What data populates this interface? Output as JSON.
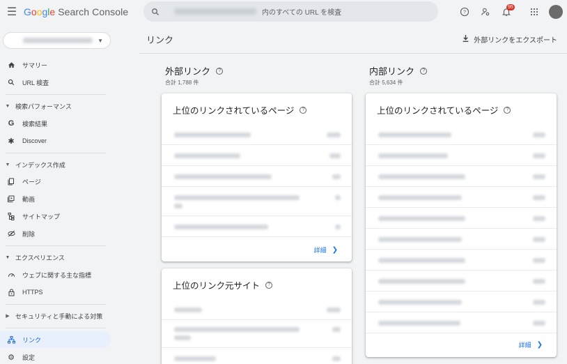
{
  "header": {
    "logo_google": [
      "G",
      "o",
      "o",
      "g",
      "l",
      "e"
    ],
    "logo_product": "Search Console",
    "search_placeholder": "内のすべての URL を検査",
    "notification_count": "95"
  },
  "sidebar": {
    "items": [
      {
        "label": "サマリー",
        "icon": "home-icon"
      },
      {
        "label": "URL 検査",
        "icon": "search-icon"
      }
    ],
    "section_performance": "検索パフォーマンス",
    "performance_items": [
      {
        "label": "検索結果",
        "icon": "google-g-icon"
      },
      {
        "label": "Discover",
        "icon": "discover-icon"
      }
    ],
    "section_index": "インデックス作成",
    "index_items": [
      {
        "label": "ページ",
        "icon": "pages-icon"
      },
      {
        "label": "動画",
        "icon": "video-icon"
      },
      {
        "label": "サイトマップ",
        "icon": "sitemap-icon"
      },
      {
        "label": "削除",
        "icon": "removals-icon"
      }
    ],
    "section_experience": "エクスペリエンス",
    "experience_items": [
      {
        "label": "ウェブに関する主な指標",
        "icon": "gauge-icon"
      },
      {
        "label": "HTTPS",
        "icon": "lock-icon"
      }
    ],
    "section_security": "セキュリティと手動による対策",
    "bottom_items": [
      {
        "label": "リンク",
        "icon": "links-icon",
        "active": true
      },
      {
        "label": "設定",
        "icon": "gear-icon"
      }
    ]
  },
  "main": {
    "title": "リンク",
    "export_label": "外部リンクをエクスポート",
    "external": {
      "heading": "外部リンク",
      "total": "合計 1,788 件",
      "top_pages_title": "上位のリンクされているページ",
      "more_label": "詳細",
      "top_sites_title": "上位のリンク元サイト"
    },
    "internal": {
      "heading": "内部リンク",
      "total": "合計 5,634 件",
      "top_pages_title": "上位のリンクされているページ",
      "more_label": "詳細"
    }
  },
  "colors": {
    "accent": "#1a73e8",
    "active_bg": "#e8f0fe",
    "badge": "#d93025"
  }
}
